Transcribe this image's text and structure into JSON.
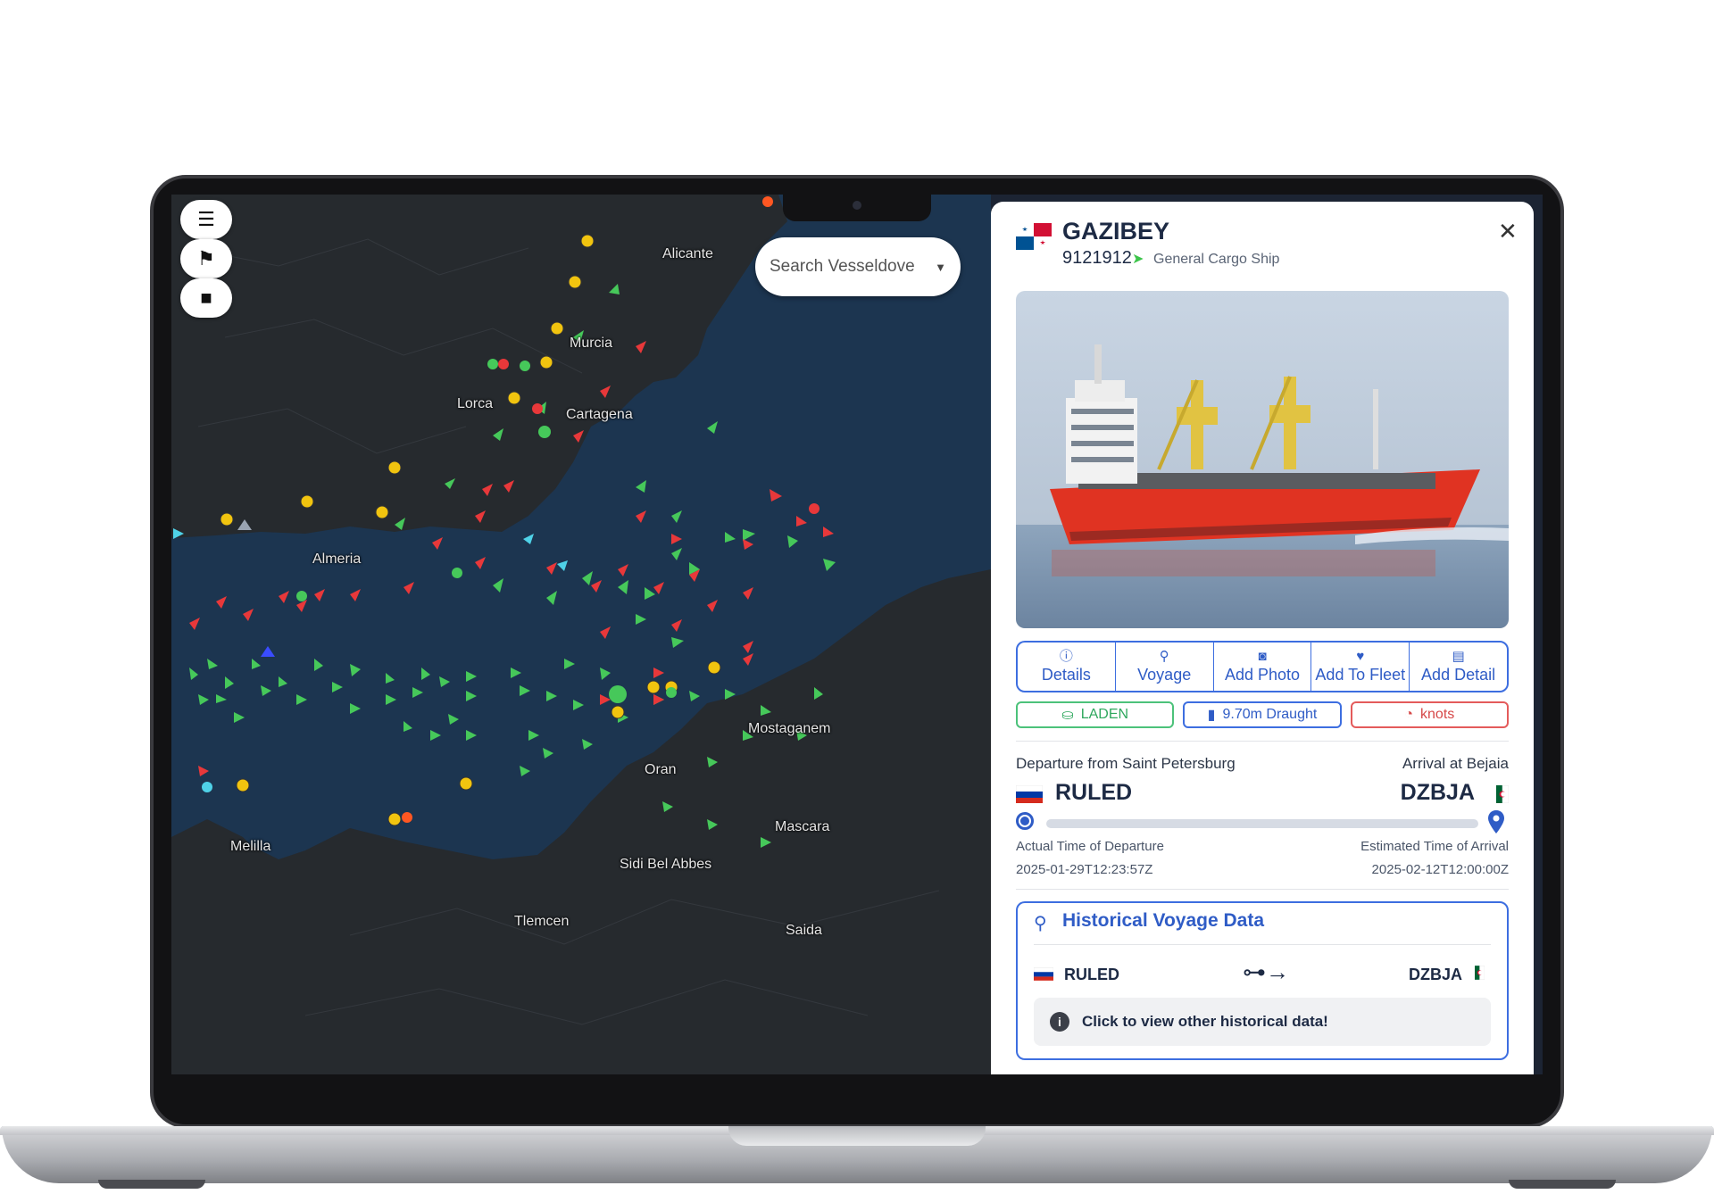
{
  "map": {
    "search_placeholder": "Search Vesseldove",
    "controls": [
      {
        "name": "menu-icon",
        "glyph": "☰"
      },
      {
        "name": "flag-icon",
        "glyph": "⚑"
      },
      {
        "name": "stop-icon",
        "glyph": "■"
      }
    ],
    "cities": [
      {
        "name": "Alicante"
      },
      {
        "name": "Murcia"
      },
      {
        "name": "Lorca"
      },
      {
        "name": "Cartagena"
      },
      {
        "name": "Almeria"
      },
      {
        "name": "Mostaganem"
      },
      {
        "name": "Oran"
      },
      {
        "name": "Mascara"
      },
      {
        "name": "Melilla"
      },
      {
        "name": "Sidi Bel Abbes"
      },
      {
        "name": "Tlemcen"
      },
      {
        "name": "Saida"
      }
    ],
    "colors": {
      "sea": "#1c3550",
      "land": "#262a2e",
      "green_ship": "#46c85a",
      "red_ship": "#e8383a",
      "anchor": "#f1c40f"
    }
  },
  "vessel": {
    "name": "GAZIBEY",
    "imo": "9121912",
    "type": "General Cargo Ship",
    "flag": "panama-flag"
  },
  "actions": [
    {
      "label": "Details",
      "icon": "info-icon"
    },
    {
      "label": "Voyage",
      "icon": "route-icon"
    },
    {
      "label": "Add Photo",
      "icon": "camera-icon"
    },
    {
      "label": "Add To Fleet",
      "icon": "heart-icon"
    },
    {
      "label": "Add Detail",
      "icon": "note-icon"
    }
  ],
  "badges": {
    "status": "LADEN",
    "draught": "9.70m Draught",
    "speed": "knots"
  },
  "voyage": {
    "departure_label": "Departure from Saint Petersburg",
    "arrival_label": "Arrival at Bejaia",
    "departure_code": "RULED",
    "arrival_code": "DZBJA",
    "atd_label": "Actual Time of Departure",
    "atd_value": "2025-01-29T12:23:57Z",
    "eta_label": "Estimated Time of Arrival",
    "eta_value": "2025-02-12T12:00:00Z"
  },
  "history": {
    "title": "Historical Voyage Data",
    "from": "RULED",
    "to": "DZBJA",
    "info": "Click to view other historical data!"
  }
}
